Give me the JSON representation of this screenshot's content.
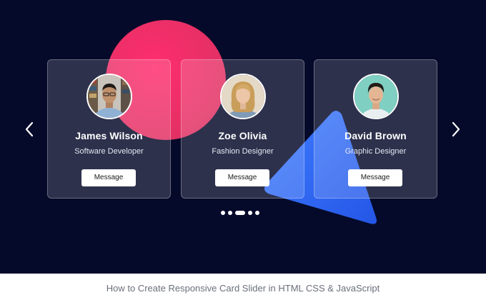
{
  "slider": {
    "cards": [
      {
        "name": "James Wilson",
        "role": "Software Developer",
        "button": "Message",
        "avatar": "man-with-glasses-photo"
      },
      {
        "name": "Zoe Olivia",
        "role": "Fashion Designer",
        "button": "Message",
        "avatar": "woman-blonde-photo"
      },
      {
        "name": "David Brown",
        "role": "Graphic Designer",
        "button": "Message",
        "avatar": "man-smiling-photo"
      }
    ],
    "prev_icon": "chevron-left-icon",
    "next_icon": "chevron-right-icon",
    "dots": {
      "count": 5,
      "active_index": 2
    }
  },
  "caption": "How to Create Responsive Card Slider in HTML CSS & JavaScript",
  "colors": {
    "background": "#050a2a",
    "circle_blob": "#e23064",
    "triangle_blob": "#2d6df0",
    "button_bg": "#ffffff"
  }
}
